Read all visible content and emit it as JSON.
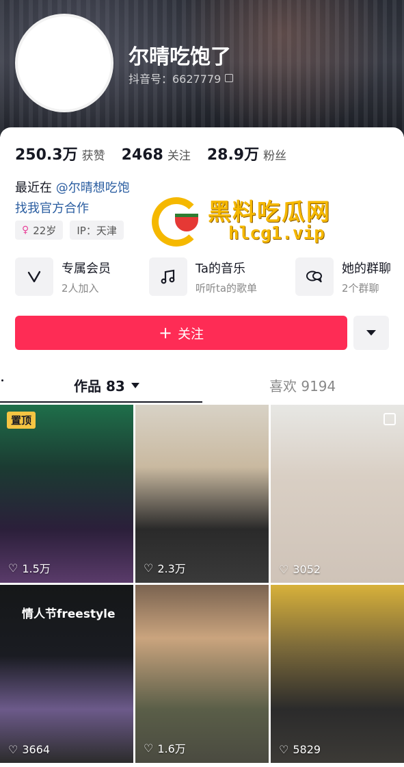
{
  "profile": {
    "name": "尔晴吃饱了",
    "douyin_id": "抖音号：6627779",
    "stats": [
      {
        "value": "250.3万",
        "label": "获赞"
      },
      {
        "value": "2468",
        "label": "关注"
      },
      {
        "value": "28.9万",
        "label": "粉丝"
      }
    ],
    "bio_prefix": "最近在",
    "bio_mention": "@尔晴想吃饱",
    "bio_link": "找我官方合作",
    "tags": {
      "age": "22岁",
      "ip": "IP：天津"
    }
  },
  "watermark": {
    "title": "黑料吃瓜网",
    "url": "hlcg1.vip"
  },
  "features": [
    {
      "title": "专属会员",
      "sub": "2人加入",
      "icon": "v-icon"
    },
    {
      "title": "Ta的音乐",
      "sub": "听听ta的歌单",
      "icon": "music-note-icon"
    },
    {
      "title": "她的群聊",
      "sub": "2个群聊",
      "icon": "chat-bubbles-icon"
    }
  ],
  "follow": {
    "label": "关注"
  },
  "tabs": {
    "works_label": "作品 83",
    "likes_label": "喜欢 9194"
  },
  "videos": [
    {
      "likes": "1.5万",
      "pinned_label": "置顶"
    },
    {
      "likes": "2.3万"
    },
    {
      "likes": "3052"
    },
    {
      "likes": "3664",
      "caption": "情人节freestyle"
    },
    {
      "likes": "1.6万"
    },
    {
      "likes": "5829"
    }
  ],
  "colors": {
    "accent": "#fe2c55",
    "link": "#2a5da0",
    "pin": "#f5c543"
  }
}
